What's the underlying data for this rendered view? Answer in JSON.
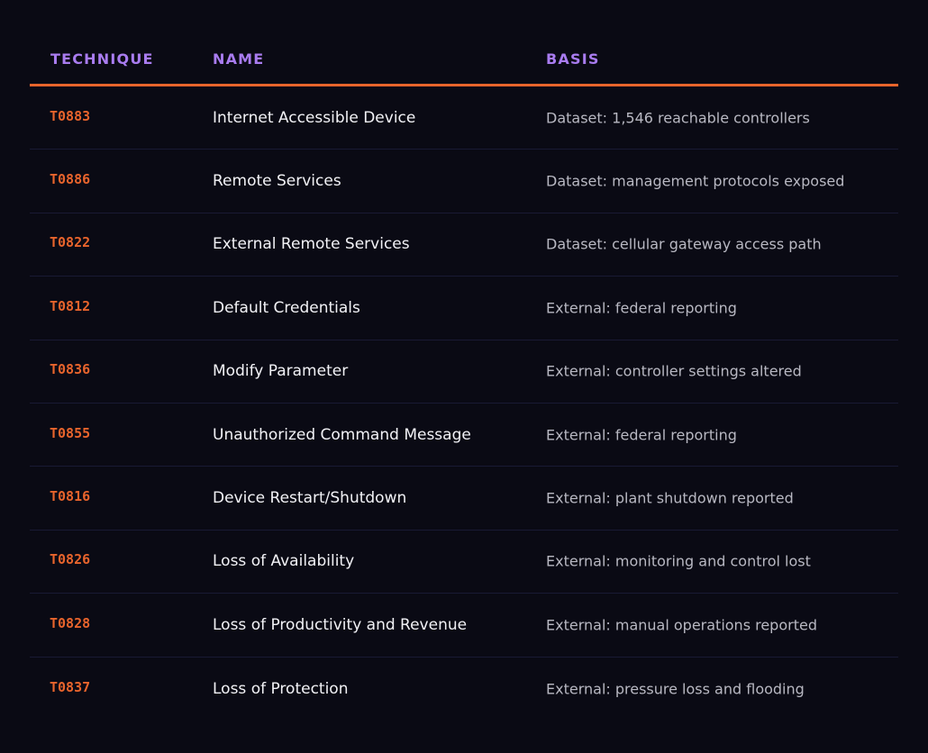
{
  "table": {
    "headers": {
      "technique": "TECHNIQUE",
      "name": "NAME",
      "basis": "BASIS"
    },
    "rows": [
      {
        "technique": "T0883",
        "name": "Internet Accessible Device",
        "basis": "Dataset: 1,546 reachable controllers"
      },
      {
        "technique": "T0886",
        "name": "Remote Services",
        "basis": "Dataset: management protocols exposed"
      },
      {
        "technique": "T0822",
        "name": "External Remote Services",
        "basis": "Dataset: cellular gateway access path"
      },
      {
        "technique": "T0812",
        "name": "Default Credentials",
        "basis": "External: federal reporting"
      },
      {
        "technique": "T0836",
        "name": "Modify Parameter",
        "basis": "External: controller settings altered"
      },
      {
        "technique": "T0855",
        "name": "Unauthorized Command Message",
        "basis": "External: federal reporting"
      },
      {
        "technique": "T0816",
        "name": "Device Restart/Shutdown",
        "basis": "External: plant shutdown reported"
      },
      {
        "technique": "T0826",
        "name": "Loss of Availability",
        "basis": "External: monitoring and control lost"
      },
      {
        "technique": "T0828",
        "name": "Loss of Productivity and Revenue",
        "basis": "External: manual operations reported"
      },
      {
        "technique": "T0837",
        "name": "Loss of Protection",
        "basis": "External: pressure loss and flooding"
      }
    ]
  },
  "colors": {
    "background": "#0a0a14",
    "header_text": "#a97cf0",
    "accent": "#e8642c",
    "name_text": "#f2f2f6",
    "basis_text": "#b8b8c2",
    "row_divider": "#191a34"
  }
}
